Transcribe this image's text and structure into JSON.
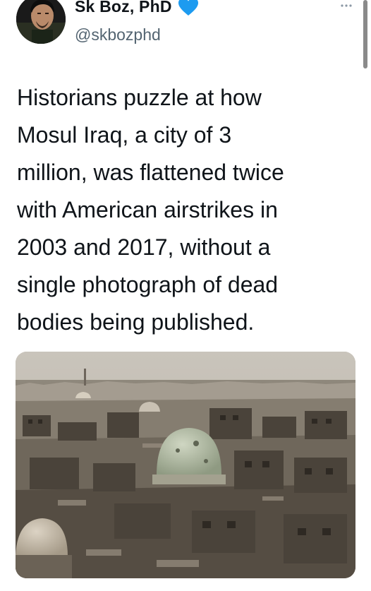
{
  "author": {
    "display_name": "Sk Boz, PhD",
    "handle": "@skbozphd",
    "verified_icon": "blue-heart-icon",
    "avatar_icon": "profile-photo"
  },
  "more_icon": "more-horizontal-icon",
  "tweet": {
    "text": "Historians puzzle at how\nMosul Iraq, a city of 3\nmillion, was flattened twice\nwith American airstrikes in\n2003 and 2017, without a\nsingle photograph of dead\nbodies being published."
  },
  "media": {
    "icon": "photo-destroyed-city-with-domes"
  },
  "colors": {
    "text": "#0f1419",
    "secondary_text": "#536471",
    "heart": "#1d9bf0"
  }
}
